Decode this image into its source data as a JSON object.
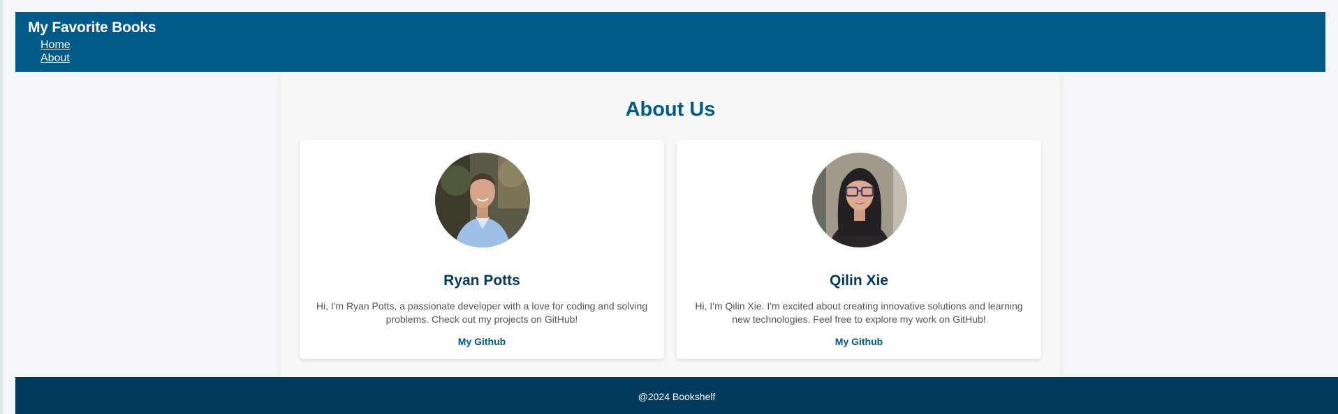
{
  "header": {
    "title": "My Favorite Books",
    "nav": [
      {
        "label": "Home"
      },
      {
        "label": "About"
      }
    ]
  },
  "main": {
    "heading": "About Us",
    "members": [
      {
        "name": "Ryan Potts",
        "bio": "Hi, I'm Ryan Potts, a passionate developer with a love for coding and solving problems. Check out my projects on GitHub!",
        "link_label": "My Github"
      },
      {
        "name": "Qilin Xie",
        "bio": "Hi, I'm Qilin Xie. I'm excited about creating innovative solutions and learning new technologies. Feel free to explore my work on GitHub!",
        "link_label": "My Github"
      }
    ]
  },
  "footer": {
    "text": "@2024 Bookshelf"
  },
  "colors": {
    "header_bg": "#005a87",
    "footer_bg": "#003a5c",
    "heading": "#005a87",
    "name": "#00395c"
  }
}
